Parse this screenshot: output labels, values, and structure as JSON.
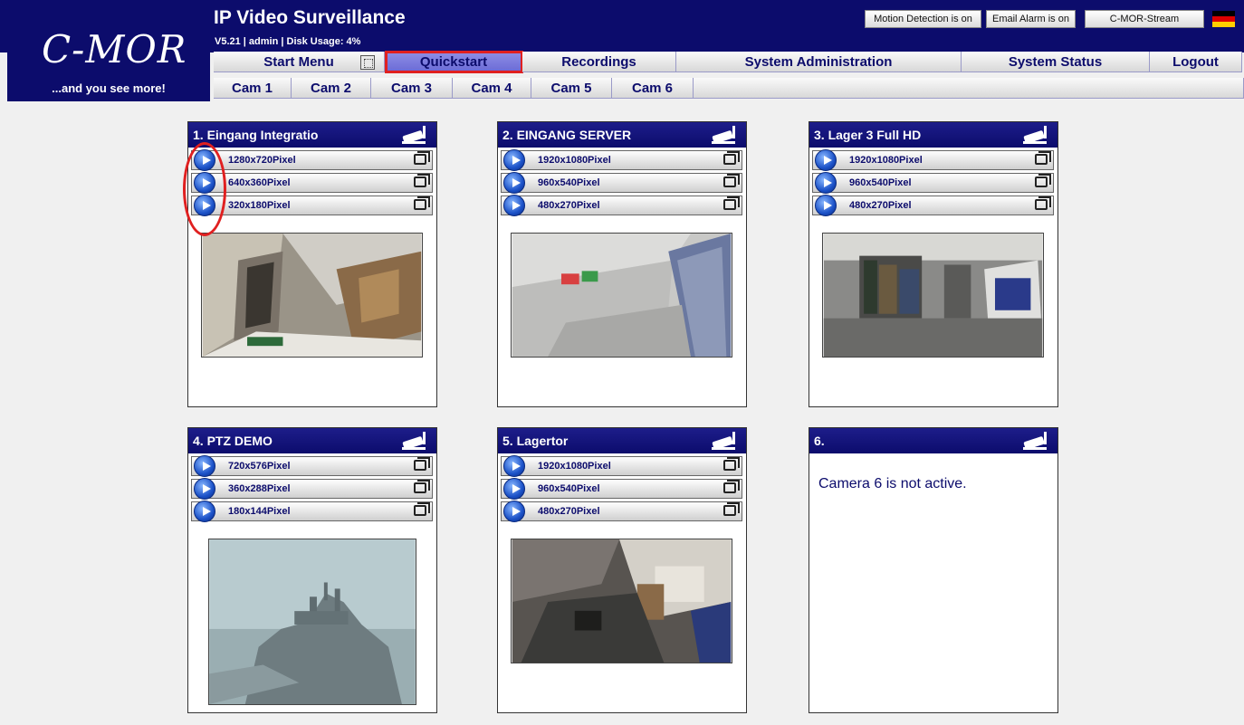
{
  "logo": {
    "text": "C-MOR",
    "tagline": "...and you see more!"
  },
  "app": {
    "title": "IP Video Surveillance",
    "subtitle": "V5.21 | admin | Disk Usage: 4%"
  },
  "status_buttons": {
    "motion": "Motion Detection is on",
    "email": "Email Alarm is on",
    "stream": "C-MOR-Stream"
  },
  "nav": {
    "main": [
      "Start Menu",
      "Quickstart",
      "Recordings",
      "System Administration",
      "System Status",
      "Logout"
    ],
    "active": "Quickstart",
    "cams": [
      "Cam 1",
      "Cam 2",
      "Cam 3",
      "Cam 4",
      "Cam 5",
      "Cam 6"
    ]
  },
  "cameras": [
    {
      "title": "1. Eingang Integratio",
      "streams": [
        "1280x720Pixel",
        "640x360Pixel",
        "320x180Pixel"
      ]
    },
    {
      "title": "2. EINGANG SERVER",
      "streams": [
        "1920x1080Pixel",
        "960x540Pixel",
        "480x270Pixel"
      ]
    },
    {
      "title": "3. Lager 3 Full HD",
      "streams": [
        "1920x1080Pixel",
        "960x540Pixel",
        "480x270Pixel"
      ]
    },
    {
      "title": "4. PTZ DEMO",
      "streams": [
        "720x576Pixel",
        "360x288Pixel",
        "180x144Pixel"
      ]
    },
    {
      "title": "5. Lagertor",
      "streams": [
        "1920x1080Pixel",
        "960x540Pixel",
        "480x270Pixel"
      ]
    },
    {
      "title": "6.",
      "streams": [],
      "message": "Camera 6 is not active."
    }
  ],
  "icons": {
    "camera": "security-camera-icon",
    "play": "play-icon",
    "popout": "popout-window-icon",
    "grid": "grid-view-icon",
    "flag": "german-flag-icon"
  },
  "colors": {
    "brand": "#0c0c6c",
    "accent": "#e02020",
    "active_tab": "#7b7bdc"
  }
}
